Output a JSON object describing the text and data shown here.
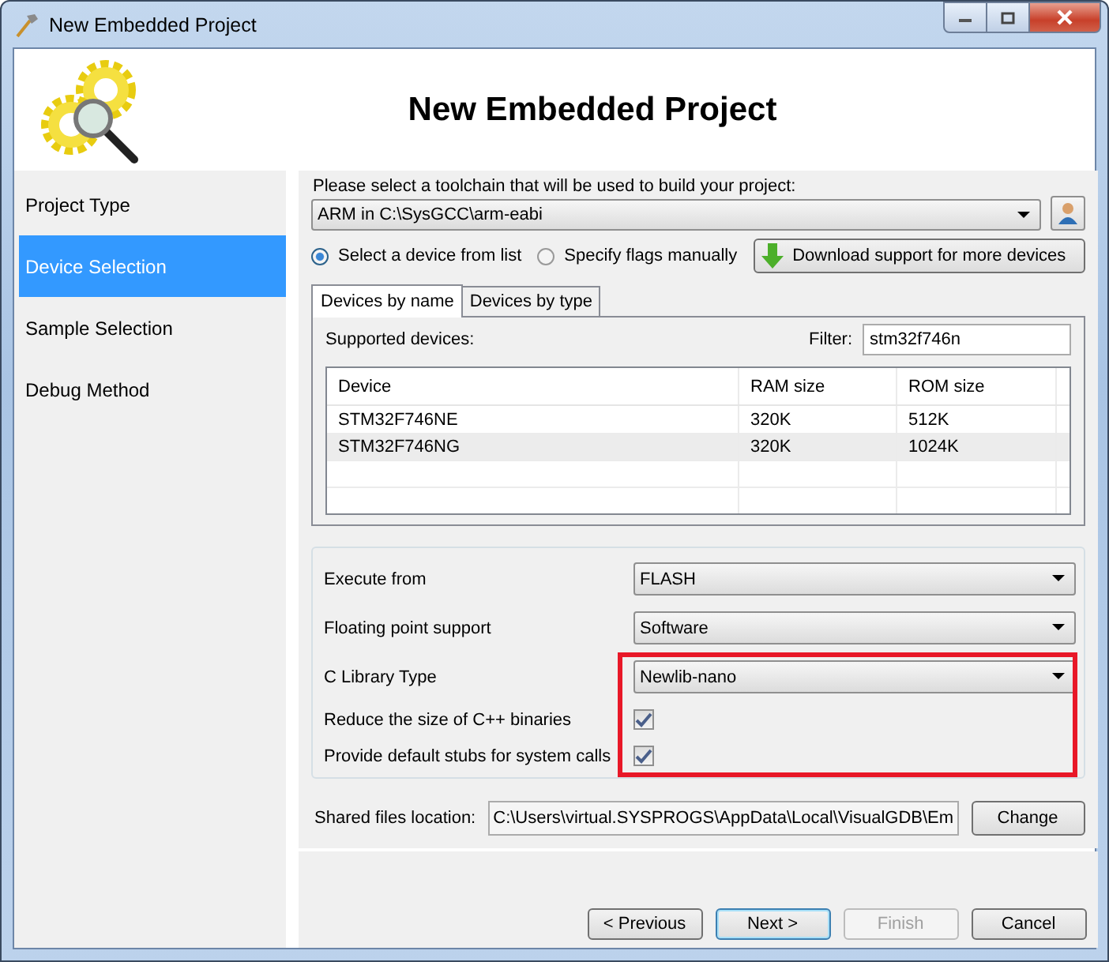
{
  "window": {
    "title": "New Embedded Project"
  },
  "header": {
    "title": "New Embedded Project"
  },
  "sidebar": {
    "items": [
      {
        "label": "Project Type",
        "selected": false
      },
      {
        "label": "Device Selection",
        "selected": true
      },
      {
        "label": "Sample Selection",
        "selected": false
      },
      {
        "label": "Debug Method",
        "selected": false
      }
    ]
  },
  "toolchain": {
    "label": "Please select a toolchain that will be used to build your project:",
    "value": "ARM in C:\\SysGCC\\arm-eabi"
  },
  "device_source": [
    {
      "label": "Select a device from list",
      "selected": true
    },
    {
      "label": "Specify flags manually",
      "selected": false
    }
  ],
  "download_button": "Download support for more devices",
  "tabs": [
    {
      "label": "Devices by name",
      "selected": true
    },
    {
      "label": "Devices by type",
      "selected": false
    }
  ],
  "device_list": {
    "supported_label": "Supported devices:",
    "filter_label": "Filter:",
    "filter_value": "stm32f746n",
    "columns": [
      "Device",
      "RAM size",
      "ROM size"
    ],
    "rows": [
      {
        "cells": [
          "STM32F746NE",
          "320K",
          "512K"
        ],
        "selected": false
      },
      {
        "cells": [
          "STM32F746NG",
          "320K",
          "1024K"
        ],
        "selected": true
      }
    ]
  },
  "settings": [
    {
      "kind": "dropdown",
      "label": "Execute from",
      "value": "FLASH",
      "highlighted": false
    },
    {
      "kind": "dropdown",
      "label": "Floating point support",
      "value": "Software",
      "highlighted": false
    },
    {
      "kind": "dropdown",
      "label": "C Library Type",
      "value": "Newlib-nano",
      "highlighted": true
    },
    {
      "kind": "checkbox",
      "label": "Reduce the size of C++ binaries",
      "checked": true,
      "highlighted": true
    },
    {
      "kind": "checkbox",
      "label": "Provide default stubs for system calls",
      "checked": true,
      "highlighted": true
    }
  ],
  "shared_files": {
    "label": "Shared files location:",
    "value": "C:\\Users\\virtual.SYSPROGS\\AppData\\Local\\VisualGDB\\Em",
    "button": "Change"
  },
  "buttons": [
    {
      "label": "< Previous",
      "disabled": false,
      "default": false
    },
    {
      "label": "Next >",
      "disabled": false,
      "default": true
    },
    {
      "label": "Finish",
      "disabled": true,
      "default": false
    },
    {
      "label": "Cancel",
      "disabled": false,
      "default": false
    }
  ]
}
